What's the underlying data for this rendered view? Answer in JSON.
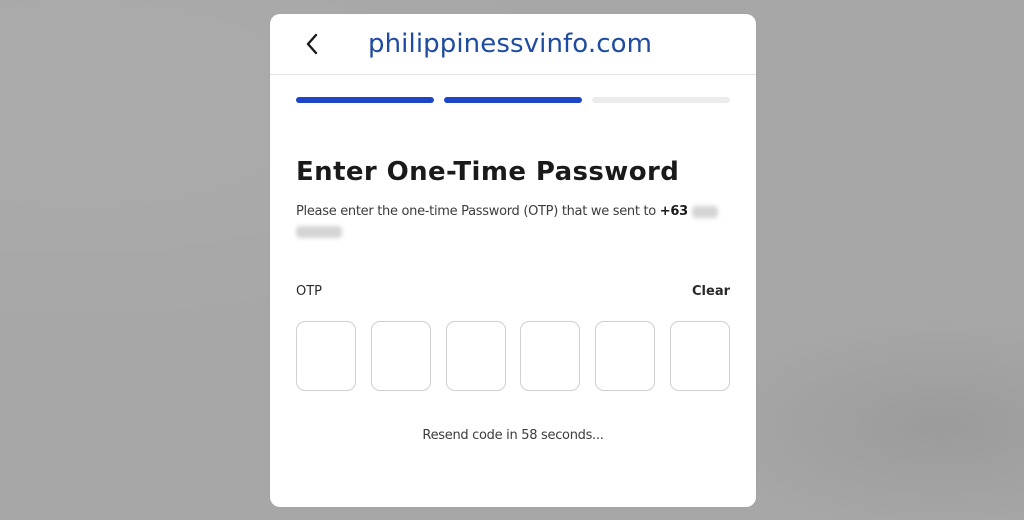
{
  "header": {
    "site_title": "philippinessvinfo.com",
    "back_icon": "chevron-left-icon"
  },
  "progress": {
    "total_steps": 3,
    "completed_steps": 2,
    "active_color": "#1d45c6",
    "inactive_color": "#ececec"
  },
  "main": {
    "heading": "Enter One-Time Password",
    "instruction": "Please enter the one-time Password (OTP) that we sent to ",
    "phone_prefix": "+63"
  },
  "otp": {
    "label": "OTP",
    "clear_label": "Clear",
    "digits": [
      "",
      "",
      "",
      "",
      "",
      ""
    ]
  },
  "resend": {
    "prefix": "Resend code in ",
    "seconds": "58",
    "suffix": " seconds..."
  },
  "colors": {
    "accent": "#1d45c6",
    "site_title": "#1f4ca0",
    "background": "#a9a9a9",
    "card": "#ffffff"
  }
}
